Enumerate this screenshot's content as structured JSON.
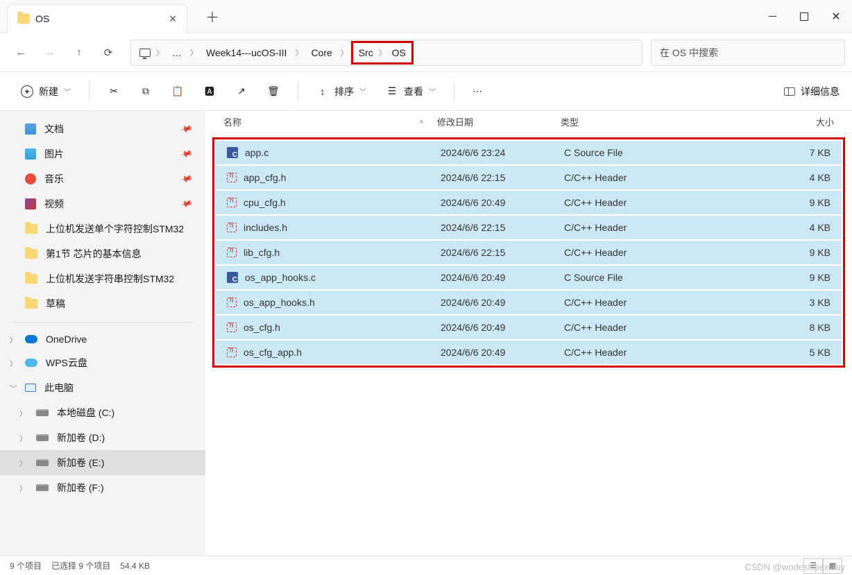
{
  "title": "OS",
  "breadcrumb": {
    "more": "…",
    "items": [
      "Week14---ucOS-III",
      "Core",
      "Src",
      "OS"
    ]
  },
  "search": {
    "placeholder": "在 OS 中搜索"
  },
  "toolbar": {
    "new": "新建",
    "sort": "排序",
    "view": "查看",
    "details": "详细信息"
  },
  "sidebar": {
    "quick": [
      {
        "label": "文档",
        "icon": "doc",
        "pin": true
      },
      {
        "label": "图片",
        "icon": "pic",
        "pin": true
      },
      {
        "label": "音乐",
        "icon": "music",
        "pin": true
      },
      {
        "label": "视频",
        "icon": "video",
        "pin": true
      },
      {
        "label": "上位机发送单个字符控制STM32",
        "icon": "folder"
      },
      {
        "label": "第1节 芯片的基本信息",
        "icon": "folder"
      },
      {
        "label": "上位机发送字符串控制STM32",
        "icon": "folder"
      },
      {
        "label": "草稿",
        "icon": "folder"
      }
    ],
    "cloud": [
      {
        "label": "OneDrive",
        "icon": "onedrive"
      },
      {
        "label": "WPS云盘",
        "icon": "wps"
      }
    ],
    "pc": {
      "label": "此电脑",
      "icon": "pc"
    },
    "drives": [
      {
        "label": "本地磁盘 (C:)"
      },
      {
        "label": "新加卷 (D:)"
      },
      {
        "label": "新加卷 (E:)"
      },
      {
        "label": "新加卷 (F:)"
      }
    ]
  },
  "columns": {
    "name": "名称",
    "date": "修改日期",
    "type": "类型",
    "size": "大小"
  },
  "files": [
    {
      "name": "app.c",
      "date": "2024/6/6 23:24",
      "type": "C Source File",
      "size": "7 KB",
      "icon": "c"
    },
    {
      "name": "app_cfg.h",
      "date": "2024/6/6 22:15",
      "type": "C/C++ Header",
      "size": "4 KB",
      "icon": "h"
    },
    {
      "name": "cpu_cfg.h",
      "date": "2024/6/6 20:49",
      "type": "C/C++ Header",
      "size": "9 KB",
      "icon": "h"
    },
    {
      "name": "includes.h",
      "date": "2024/6/6 22:15",
      "type": "C/C++ Header",
      "size": "4 KB",
      "icon": "h"
    },
    {
      "name": "lib_cfg.h",
      "date": "2024/6/6 22:15",
      "type": "C/C++ Header",
      "size": "9 KB",
      "icon": "h"
    },
    {
      "name": "os_app_hooks.c",
      "date": "2024/6/6 20:49",
      "type": "C Source File",
      "size": "9 KB",
      "icon": "c"
    },
    {
      "name": "os_app_hooks.h",
      "date": "2024/6/6 20:49",
      "type": "C/C++ Header",
      "size": "3 KB",
      "icon": "h"
    },
    {
      "name": "os_cfg.h",
      "date": "2024/6/6 20:49",
      "type": "C/C++ Header",
      "size": "8 KB",
      "icon": "h"
    },
    {
      "name": "os_cfg_app.h",
      "date": "2024/6/6 20:49",
      "type": "C/C++ Header",
      "size": "5 KB",
      "icon": "h"
    }
  ],
  "status": {
    "count": "9 个项目",
    "selected": "已选择 9 个项目",
    "size": "54.4 KB"
  },
  "watermark": "CSDN @wodeshijiexiaay"
}
